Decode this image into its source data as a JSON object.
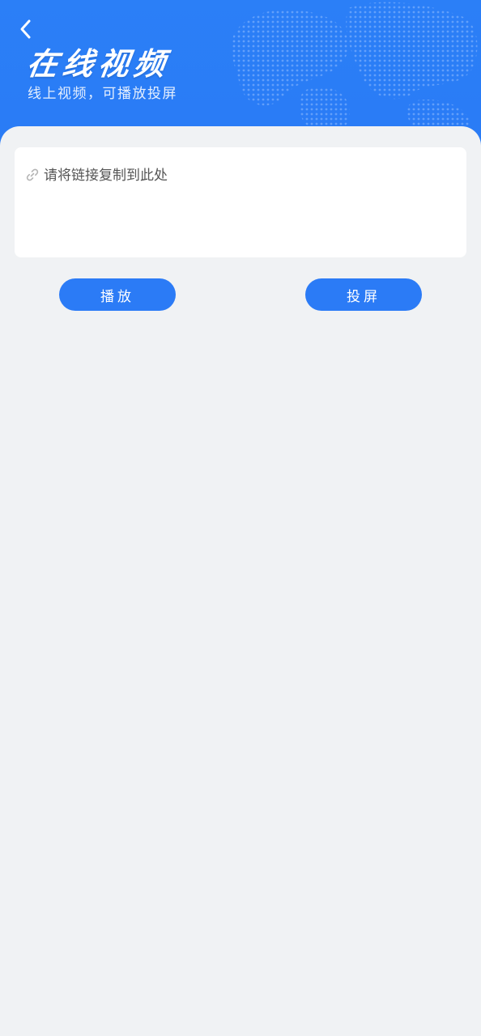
{
  "header": {
    "title": "在线视频",
    "subtitle": "线上视频，可播放投屏",
    "back_icon": "chevron-left-icon",
    "background_color": "#2b7ff7"
  },
  "link_input": {
    "placeholder": "请将链接复制到此处",
    "value": "",
    "icon": "link-icon"
  },
  "actions": {
    "play_label": "播放",
    "cast_label": "投屏",
    "button_color": "#2b7bf6"
  }
}
